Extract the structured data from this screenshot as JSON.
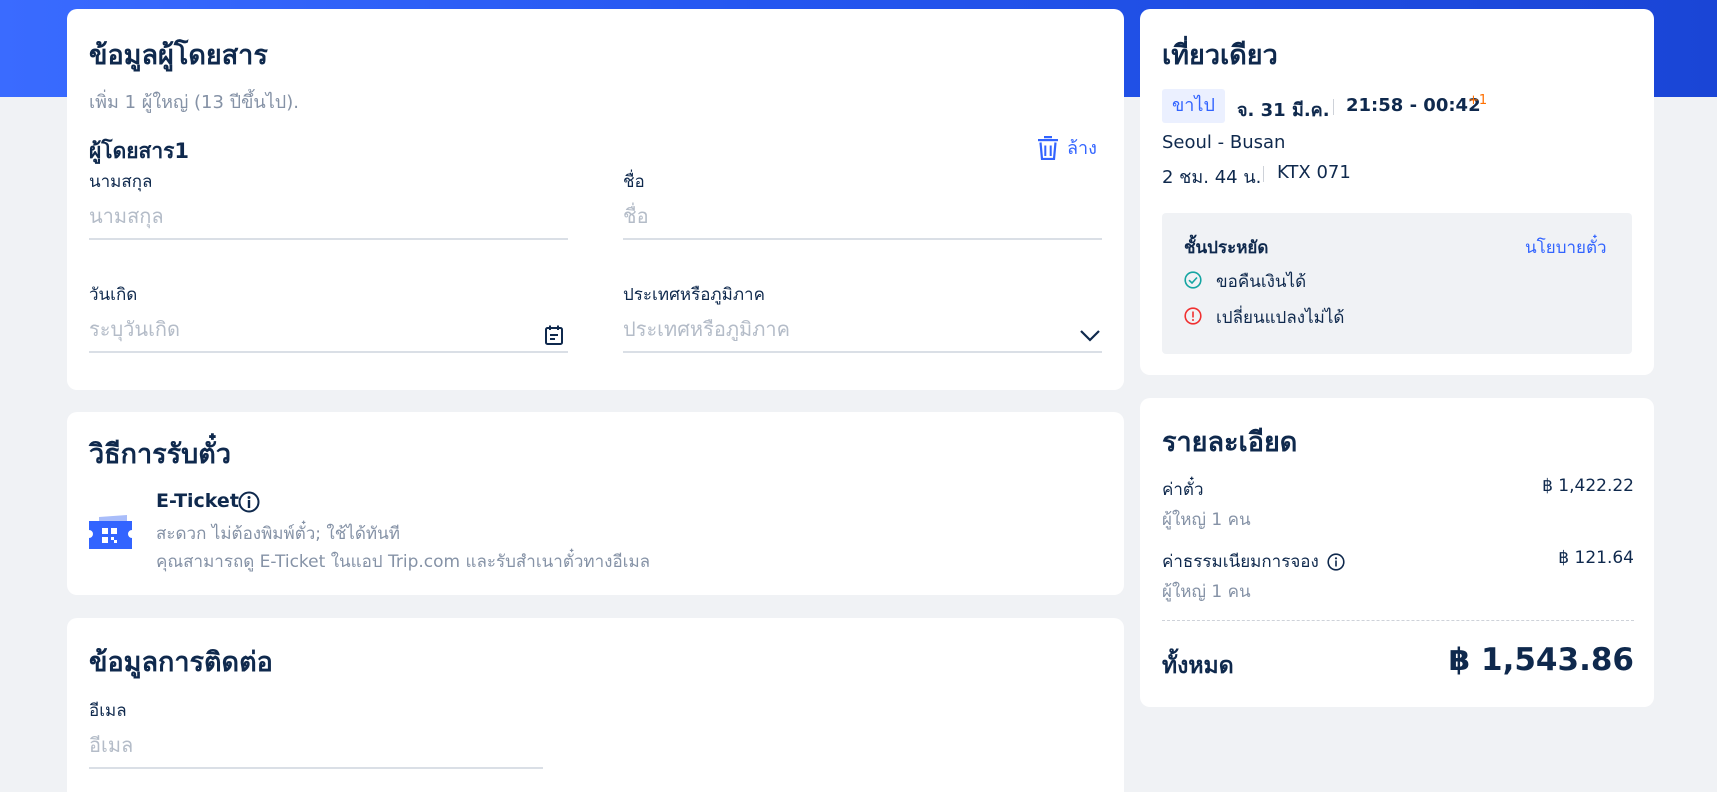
{
  "passenger": {
    "title": "ข้อมูลผู้โดยสาร",
    "subtitle": "เพิ่ม 1 ผู้ใหญ่ (13 ปีขึ้นไป).",
    "passenger_label": "ผู้โดยสาร1",
    "clear_label": "ล้าง",
    "surname_label": "นามสกุล",
    "surname_placeholder": "นามสกุล",
    "given_name_label": "ชื่อ",
    "given_name_placeholder": "ชื่อ",
    "birthdate_label": "วันเกิด",
    "birthdate_placeholder": "ระบุวันเกิด",
    "country_label": "ประเทศหรือภูมิภาค",
    "country_placeholder": "ประเทศหรือภูมิภาค"
  },
  "ticket_method": {
    "title": "วิธีการรับตั๋ว",
    "option_name": "E-Ticket",
    "line1": "สะดวก ไม่ต้องพิมพ์ตั๋ว; ใช้ได้ทันที",
    "line2": "คุณสามารถดู E-Ticket ในแอป Trip.com และรับสำเนาตั๋วทางอีเมล"
  },
  "contact": {
    "title": "ข้อมูลการติดต่อ",
    "email_label": "อีเมล",
    "email_placeholder": "อีเมล"
  },
  "trip": {
    "title": "เที่ยวเดียว",
    "direction_chip": "ขาไป",
    "date": "จ. 31 มี.ค.",
    "time": "21:58 - 00:42",
    "day_offset": "+1",
    "route": "Seoul - Busan",
    "duration": "2 ชม. 44 น.",
    "train_no": "KTX 071",
    "fare_class": "ชั้นประหยัด",
    "policy_link": "นโยบายตั๋ว",
    "refund": "ขอคืนเงินได้",
    "change": "เปลี่ยนแปลงไม่ได้"
  },
  "details": {
    "title": "รายละเอียด",
    "fare_label": "ค่าตั๋ว",
    "fare_value": "฿ 1,422.22",
    "fare_sub": "ผู้ใหญ่ 1 คน",
    "fee_label": "ค่าธรรมเนียมการจอง",
    "fee_value": "฿ 121.64",
    "fee_sub": "ผู้ใหญ่ 1 คน",
    "total_label": "ทั้งหมด",
    "total_value": "฿ 1,543.86"
  },
  "colors": {
    "accent": "#3264ff",
    "ok": "#14a5a2",
    "warn": "#f03030",
    "offset": "#ff6f00"
  }
}
